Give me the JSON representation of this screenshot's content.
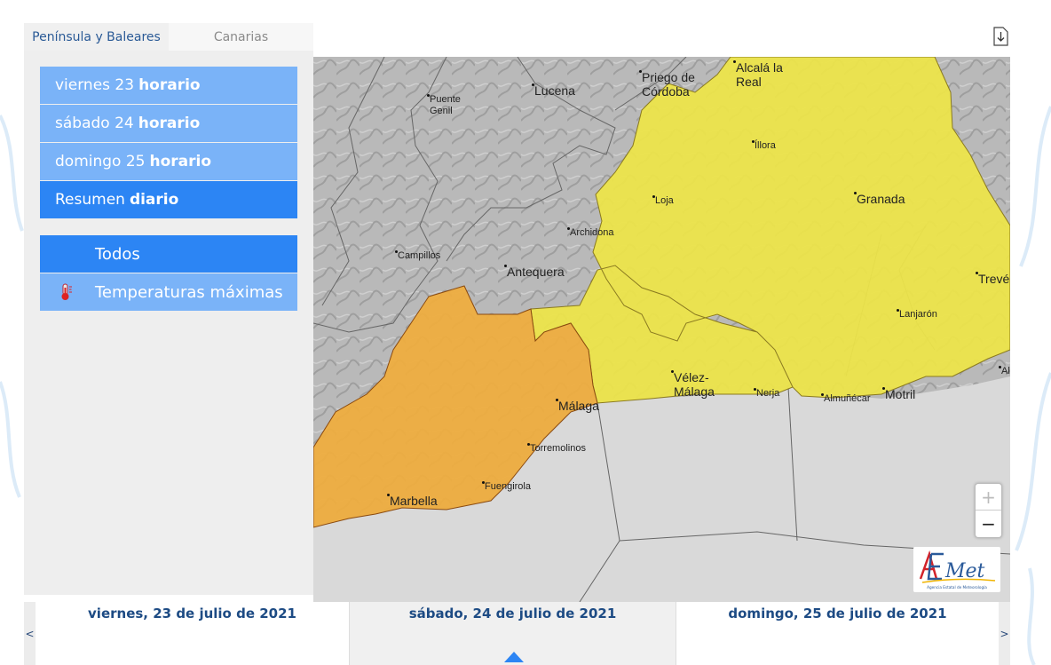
{
  "region_tabs": [
    {
      "label": "Península y Baleares",
      "active": true
    },
    {
      "label": "Canarias",
      "active": false
    }
  ],
  "days": [
    {
      "label": "viernes 23",
      "bold": "horario"
    },
    {
      "label": "sábado 24",
      "bold": "horario"
    },
    {
      "label": "domingo 25",
      "bold": "horario"
    },
    {
      "label": "Resumen",
      "bold": "diario",
      "selected": true
    }
  ],
  "phenomena": [
    {
      "label": "Todos",
      "icon": "none"
    },
    {
      "label": "Temperaturas máximas",
      "icon": "thermometer-icon"
    }
  ],
  "map": {
    "zoom_in": "+",
    "zoom_out": "−",
    "logo_text": "AEmet",
    "logo_subtitle": "Agencia Estatal de Meteorología",
    "colors": {
      "yellow_warning": "#ece44a",
      "orange_warning": "#eead3f",
      "terrain": "#b7b7b7",
      "sea": "#d9d9d9"
    },
    "cities": [
      {
        "name": "Puente\nGenil"
      },
      {
        "name": "Lucena"
      },
      {
        "name": "Priego de\nCórdoba"
      },
      {
        "name": "Alcalá la\nReal"
      },
      {
        "name": "Íllora"
      },
      {
        "name": "Loja"
      },
      {
        "name": "Granada"
      },
      {
        "name": "Archidona"
      },
      {
        "name": "Campillos"
      },
      {
        "name": "Antequera"
      },
      {
        "name": "Trevél"
      },
      {
        "name": "Lanjarón"
      },
      {
        "name": "Vélez-\nMálaga"
      },
      {
        "name": "Nerja"
      },
      {
        "name": "Almuñécar"
      },
      {
        "name": "Motril"
      },
      {
        "name": "Al"
      },
      {
        "name": "Málaga"
      },
      {
        "name": "Torremolinos"
      },
      {
        "name": "Fuengirola"
      },
      {
        "name": "Marbella"
      }
    ]
  },
  "timeline": {
    "prev": "<",
    "next": ">",
    "days": [
      {
        "label": "viernes, 23 de julio de 2021"
      },
      {
        "label": "sábado, 24 de julio de 2021",
        "selected": true
      },
      {
        "label": "domingo, 25 de julio de 2021"
      }
    ]
  }
}
